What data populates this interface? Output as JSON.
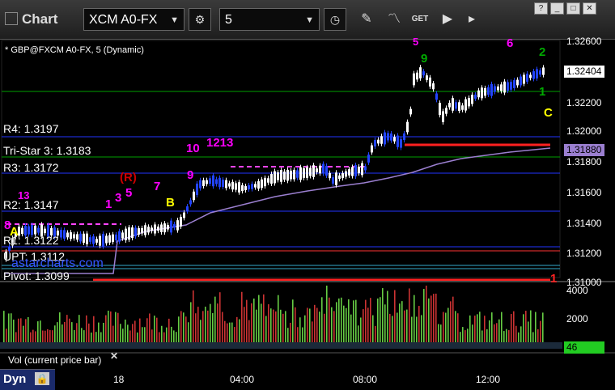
{
  "app": {
    "title": "Chart"
  },
  "toolbar": {
    "symbol": "XCM A0-FX",
    "interval": "5",
    "get_label": "GET"
  },
  "chart": {
    "caption": "* GBP@FXCM A0-FX, 5 (Dynamic)",
    "levels": [
      {
        "text": "R4: 1.3197"
      },
      {
        "text": "Tri-Star 3: 1.3183"
      },
      {
        "text": "R3: 1.3172"
      },
      {
        "text": "R2: 1.3147"
      },
      {
        "text": "R1: 1.3122"
      },
      {
        "text": "UPT: 1.3112"
      },
      {
        "text": "Pivot: 1.3099"
      }
    ],
    "watermark": "astarcharts.com",
    "markers": [
      {
        "text": "A",
        "color": "#ffff00"
      },
      {
        "text": "B",
        "color": "#ffff00"
      },
      {
        "text": "C",
        "color": "#ffff00"
      },
      {
        "text": "(R)",
        "color": "#cc0000"
      },
      {
        "text": "8",
        "color": "#ff00ff"
      },
      {
        "text": "13",
        "color": "#ff00ff"
      },
      {
        "text": "1",
        "color": "#ff00ff"
      },
      {
        "text": "3",
        "color": "#ff00ff"
      },
      {
        "text": "5",
        "color": "#ff00ff"
      },
      {
        "text": "7",
        "color": "#ff00ff"
      },
      {
        "text": "9",
        "color": "#ff00ff"
      },
      {
        "text": "10",
        "color": "#ff00ff"
      },
      {
        "text": "1213",
        "color": "#ff00ff"
      },
      {
        "text": "5",
        "color": "#ff00ff"
      },
      {
        "text": "6",
        "color": "#ff00ff"
      },
      {
        "text": "9",
        "color": "#00aa00"
      },
      {
        "text": "2",
        "color": "#00aa00"
      },
      {
        "text": "1",
        "color": "#00aa00"
      },
      {
        "text": "1",
        "color": "#ff2222"
      }
    ],
    "price_axis": [
      "1.32600",
      "1.32200",
      "1.32000",
      "1.31800",
      "1.31600",
      "1.31400",
      "1.31200",
      "1.31000"
    ],
    "last_price": "1.32404",
    "ma_price": "1.31880",
    "volume_axis": [
      "4000",
      "2000"
    ],
    "volume_label": "Vol (current price bar)",
    "volume_value": "46",
    "time_axis": [
      "18",
      "04:00",
      "08:00",
      "12:00"
    ],
    "status": "Dyn"
  },
  "colors": {
    "background": "#000000",
    "price_tag": "#ffffff",
    "ma": "#9b7fd0",
    "volume_up": "#66cc44",
    "volume_down": "#cc3333",
    "volume_tag": "#22cc22"
  }
}
